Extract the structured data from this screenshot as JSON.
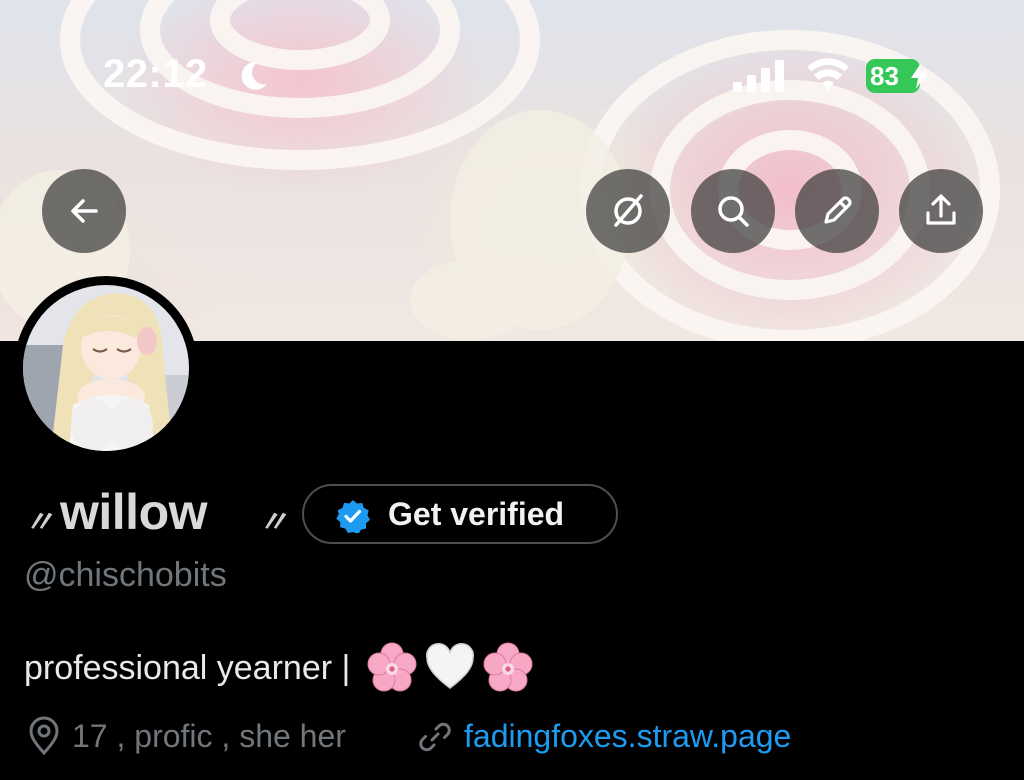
{
  "status_bar": {
    "time": "22:12",
    "battery": "83",
    "icons": [
      "moon-icon",
      "cellular-signal-icon",
      "wifi-icon",
      "battery-charging-icon"
    ]
  },
  "header_actions": {
    "back": "back-arrow-icon",
    "grok": "grok-icon",
    "search": "search-icon",
    "edit": "pencil-icon",
    "share": "share-icon"
  },
  "profile": {
    "deco_left": "〃",
    "display_name": "willow",
    "deco_right": "〃",
    "verify_button_label": "Get verified",
    "handle": "@chischobits",
    "bio_text": "professional yearner |",
    "bio_emojis": [
      "cherry-blossom",
      "white-heart",
      "cherry-blossom"
    ],
    "location": "17 , profic , she her",
    "website": "fadingfoxes.straw.page"
  },
  "colors": {
    "background": "#000000",
    "accent_blue": "#1d9bf0",
    "muted_text": "#71767b",
    "battery_green": "#36c759"
  }
}
